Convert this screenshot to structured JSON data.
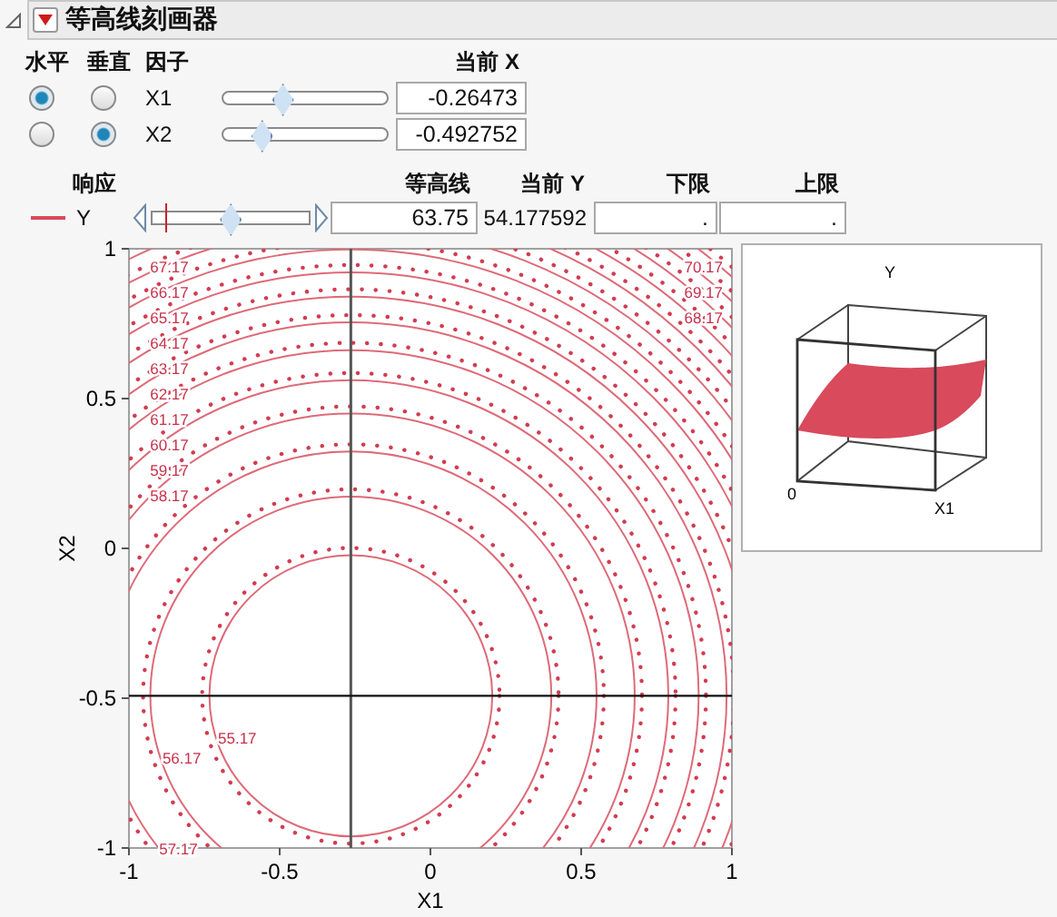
{
  "panel": {
    "title": "等高线刻画器",
    "expanded": true
  },
  "factor_headers": {
    "horizontal": "水平",
    "vertical": "垂直",
    "factor": "因子",
    "current": "当前 X"
  },
  "factors": [
    {
      "name": "X1",
      "horizontal": true,
      "vertical": false,
      "level": 0.368,
      "current": "-0.26473"
    },
    {
      "name": "X2",
      "horizontal": false,
      "vertical": true,
      "level": 0.254,
      "current": "-0.492752"
    }
  ],
  "response_headers": {
    "response": "响应",
    "contour": "等高线",
    "current": "当前 Y",
    "lower": "下限",
    "upper": "上限"
  },
  "responses": [
    {
      "name": "Y",
      "level": 0.49,
      "current_marker": {
        "level": 0.09
      },
      "contour": "63.75",
      "current": "54.177592",
      "lower": ".",
      "upper": "."
    }
  ],
  "contour_plot": {
    "x_label": "X1",
    "y_label": "X2",
    "x_ticks": [
      "-1",
      "-0.5",
      "0",
      "0.5",
      "1"
    ],
    "y_ticks": [
      "1",
      "0.5",
      "0",
      "-0.5",
      "-1"
    ],
    "contour_labels": [
      "67.17",
      "70.17",
      "66.17",
      "69.17",
      "65.17",
      "68.17",
      "64.17",
      "63.17",
      "62.17",
      "61.17",
      "60.17",
      "59.17",
      "58.17",
      "55.17",
      "56.17",
      "57.17"
    ]
  },
  "surface_plot": {
    "title": "Y",
    "origin_label": "0",
    "x_label": "X1"
  }
}
